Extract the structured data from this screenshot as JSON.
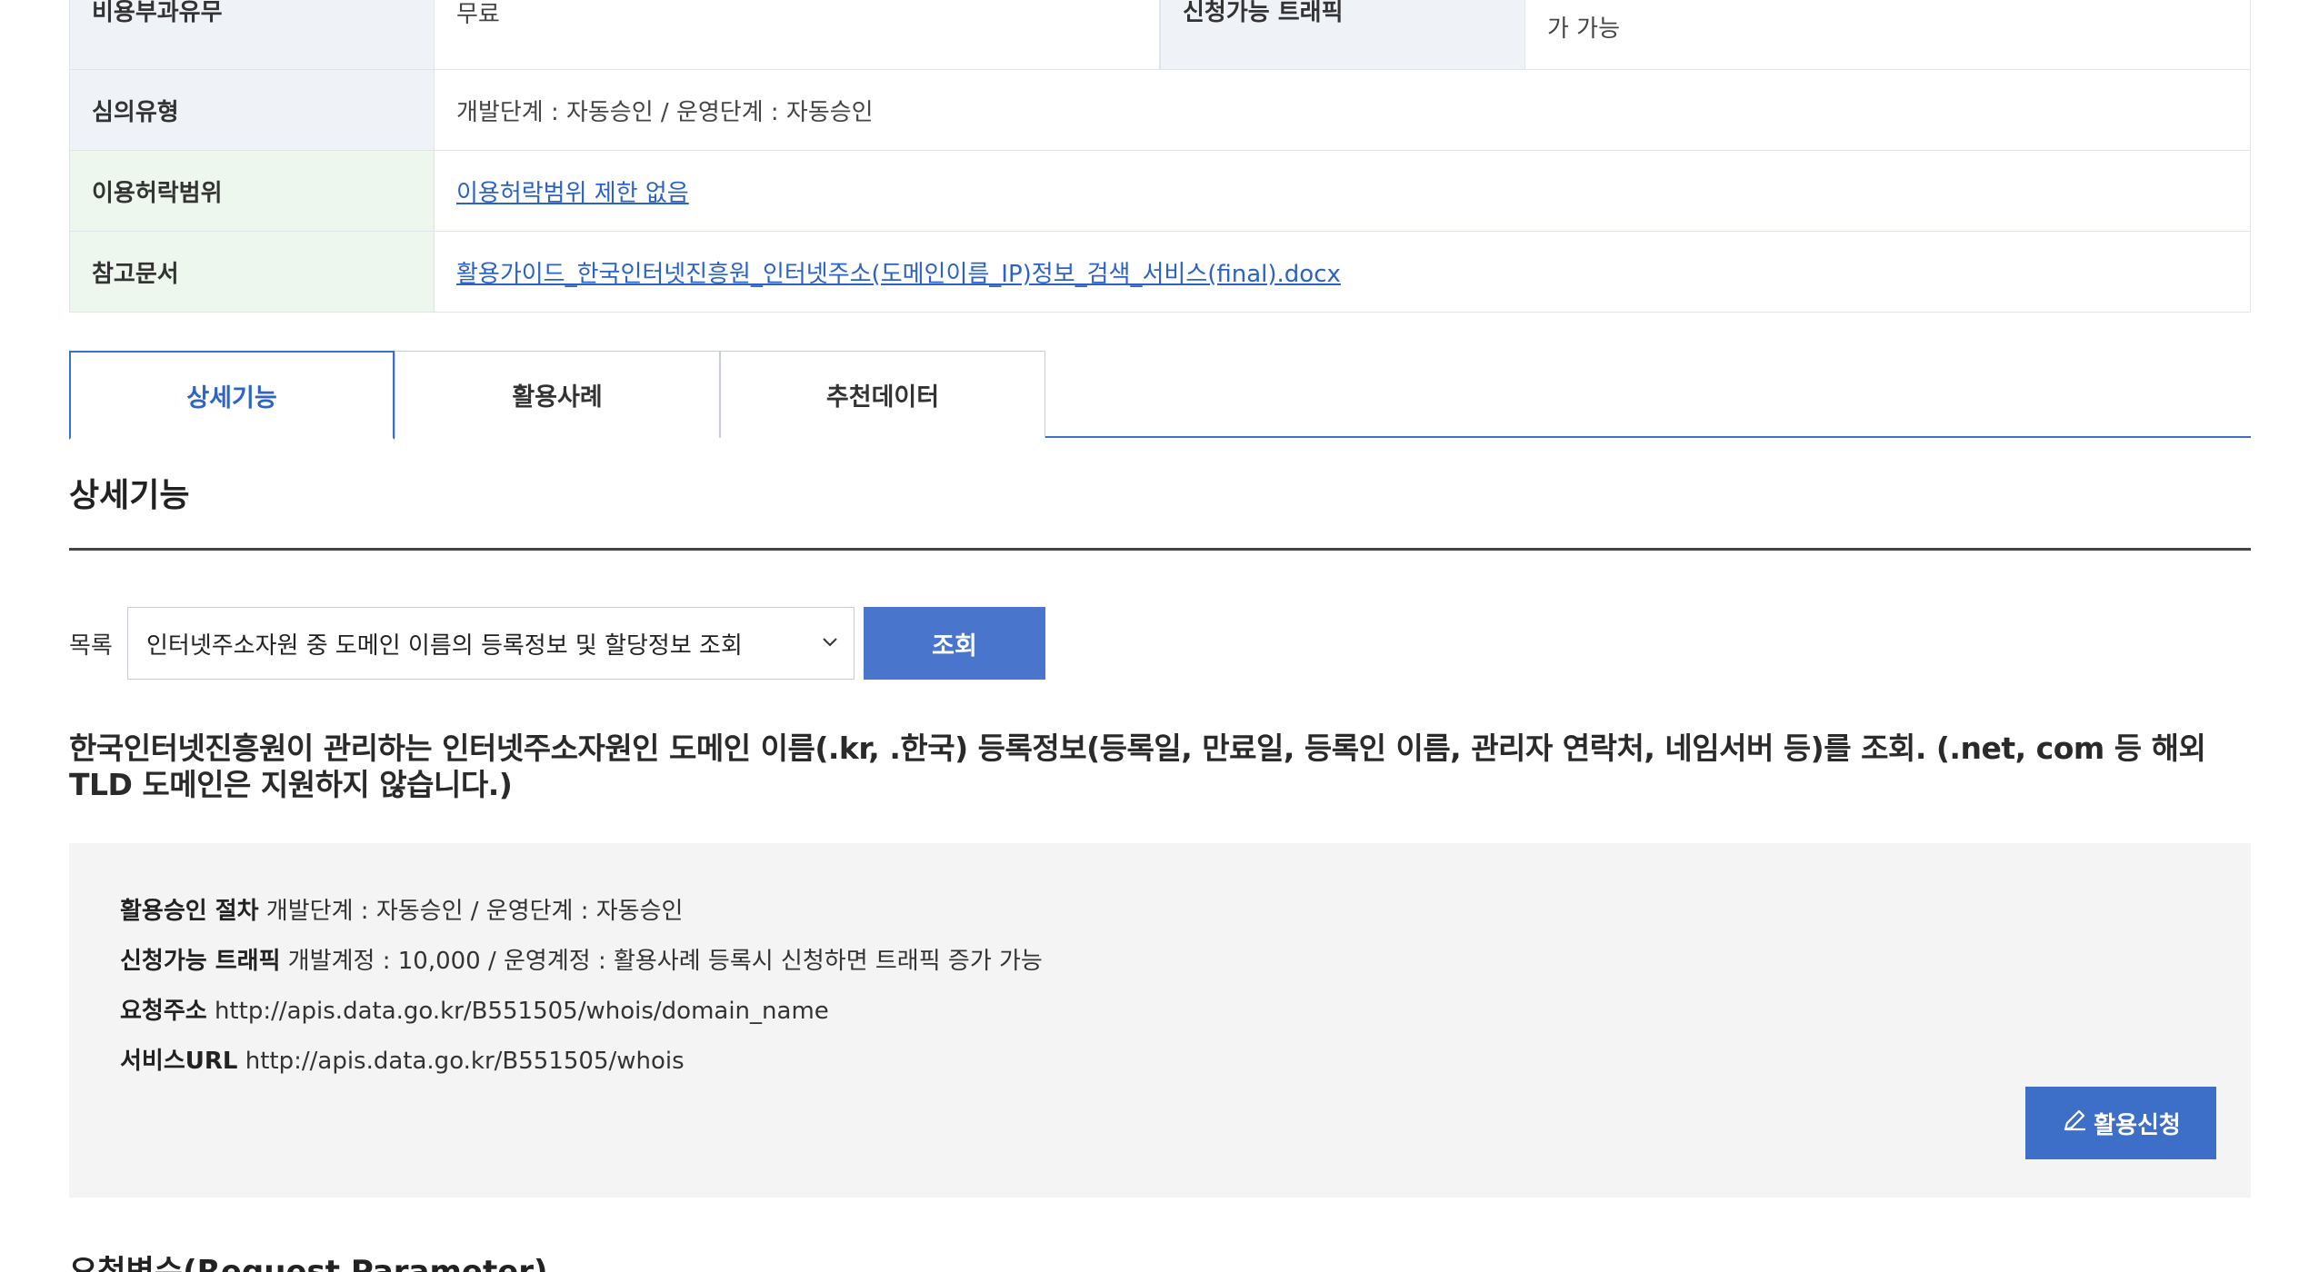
{
  "info_table": {
    "row0": {
      "label1": "비용부과유무",
      "value1": "무료",
      "label2": "신청가능 트래픽",
      "value2": "가 가능"
    },
    "row1": {
      "label": "심의유형",
      "value": "개발단계 : 자동승인 / 운영단계 : 자동승인"
    },
    "row2": {
      "label": "이용허락범위",
      "value": "이용허락범위 제한 없음"
    },
    "row3": {
      "label": "참고문서",
      "value": "활용가이드_한국인터넷진흥원_인터넷주소(도메인이름_IP)정보_검색_서비스(final).docx"
    }
  },
  "tabs": [
    {
      "label": "상세기능"
    },
    {
      "label": "활용사례"
    },
    {
      "label": "추천데이터"
    }
  ],
  "section_title": "상세기능",
  "list": {
    "label": "목록",
    "selected": "인터넷주소자원 중 도메인 이름의 등록정보 및 할당정보 조회",
    "query_button": "조회"
  },
  "description": "한국인터넷진흥원이 관리하는 인터넷주소자원인 도메인 이름(.kr, .한국) 등록정보(등록일, 만료일, 등록인 이름, 관리자 연락처, 네임서버 등)를 조회. (.net, com 등 해외 TLD 도메인은 지원하지 않습니다.)",
  "details": {
    "approval_label": "활용승인 절차",
    "approval_value": "개발단계 : 자동승인 / 운영단계 : 자동승인",
    "traffic_label": "신청가능 트래픽",
    "traffic_value": "개발계정 : 10,000 / 운영계정 : 활용사례 등록시 신청하면 트래픽 증가 가능",
    "request_label": "요청주소",
    "request_value": "http://apis.data.go.kr/B551505/whois/domain_name",
    "service_label": "서비스URL",
    "service_value": "http://apis.data.go.kr/B551505/whois",
    "apply_button": "활용신청"
  },
  "bottom_title": "요청변수(Request Parameter)",
  "colors": {
    "accent": "#3d6fc9",
    "link": "#2b62c8"
  }
}
